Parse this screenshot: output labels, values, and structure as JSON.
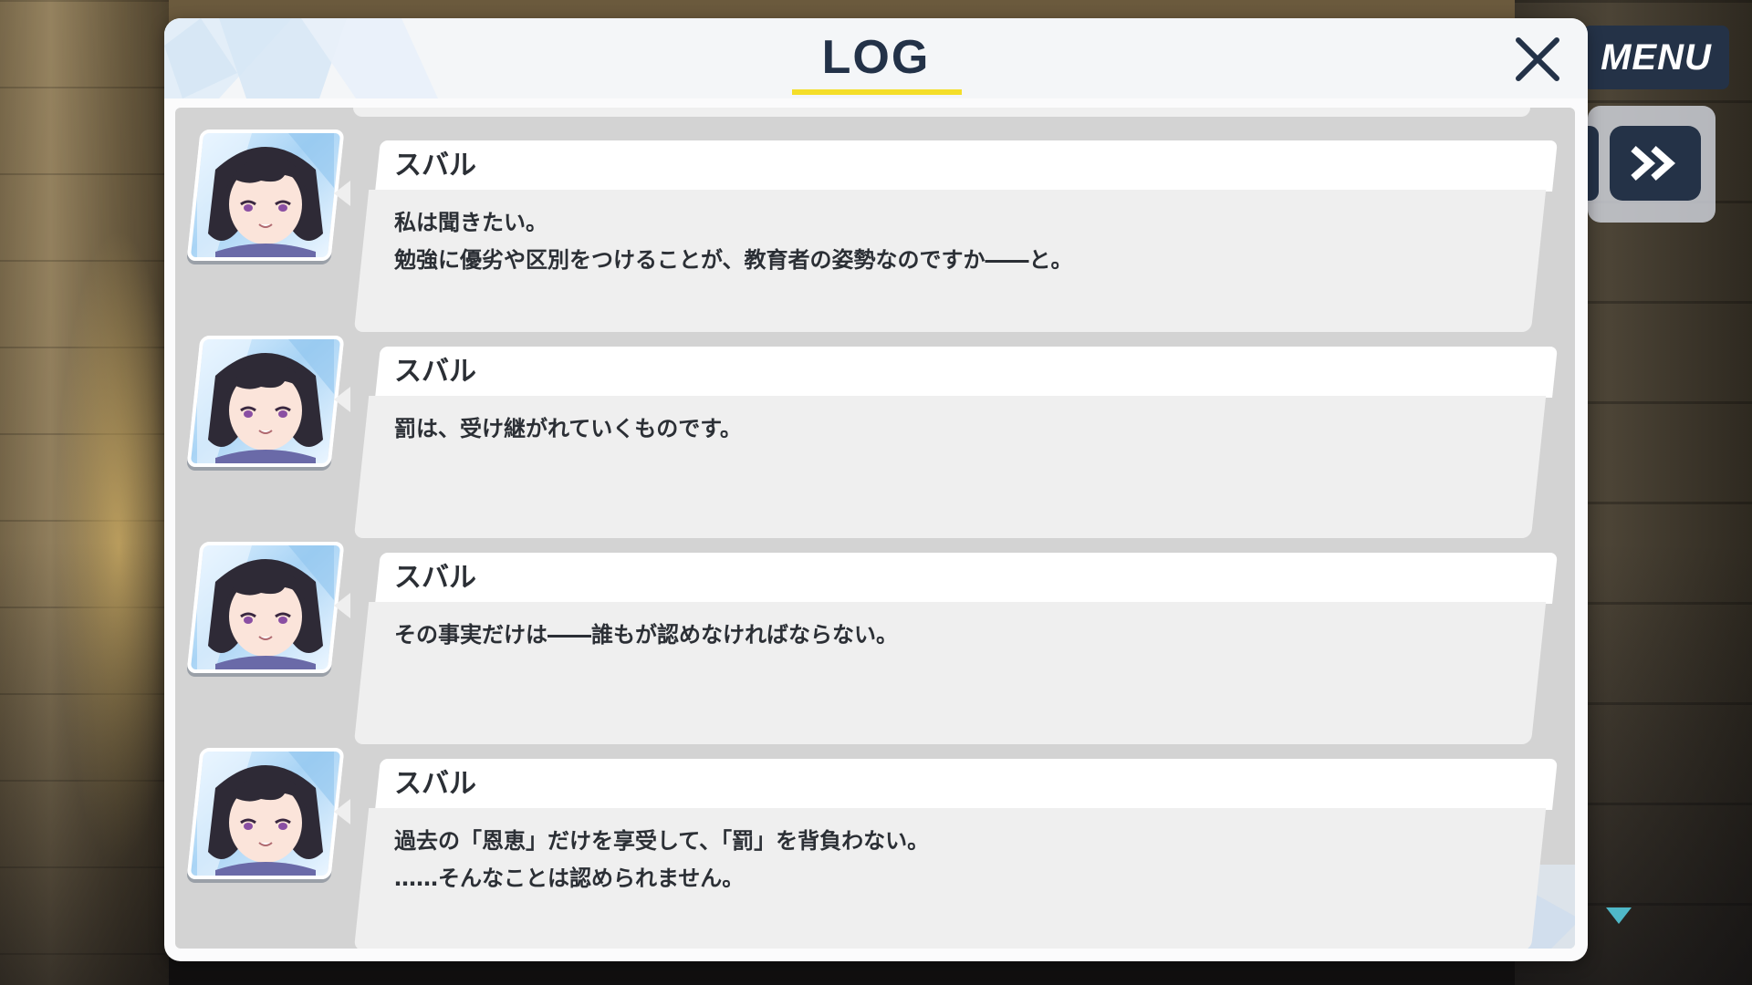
{
  "menu": {
    "label": "MENU"
  },
  "dialog": {
    "title": "LOG",
    "accent_color": "#f4de2a",
    "title_color": "#233248",
    "close_icon": "close-icon"
  },
  "fast_forward": {
    "icon": "fast-forward-icon"
  },
  "scroll_indicator": {
    "icon": "chevron-down-icon",
    "color": "#4fb8c8"
  },
  "entries": [
    {
      "speaker": "スバル",
      "lines": [
        "私は聞きたい。",
        "勉強に優劣や区別をつけることが、教育者の姿勢なのですか――と。"
      ]
    },
    {
      "speaker": "スバル",
      "lines": [
        "罰は、受け継がれていくものです。"
      ]
    },
    {
      "speaker": "スバル",
      "lines": [
        "その事実だけは――誰もが認めなければならない。"
      ]
    },
    {
      "speaker": "スバル",
      "lines": [
        "過去の「恩恵」だけを享受して、「罰」を背負わない。",
        "……そんなことは認められません。"
      ]
    }
  ]
}
